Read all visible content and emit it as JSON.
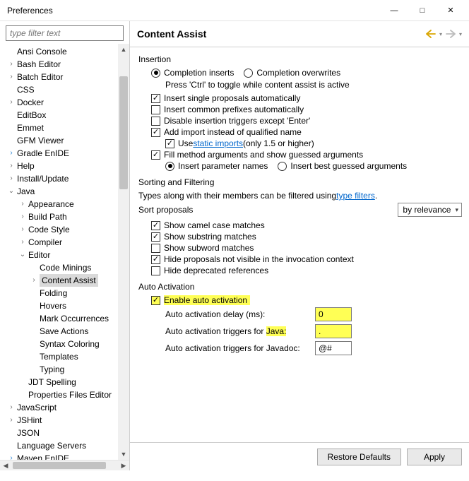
{
  "window": {
    "title": "Preferences"
  },
  "filter": {
    "placeholder": "type filter text"
  },
  "tree": {
    "items": [
      {
        "label": "Ansi Console",
        "tw": "",
        "depth": 0
      },
      {
        "label": "Bash Editor",
        "tw": ">",
        "depth": 0
      },
      {
        "label": "Batch Editor",
        "tw": ">",
        "depth": 0
      },
      {
        "label": "CSS",
        "tw": "",
        "depth": 0
      },
      {
        "label": "Docker",
        "tw": ">",
        "depth": 0
      },
      {
        "label": "EditBox",
        "tw": "",
        "depth": 0
      },
      {
        "label": "Emmet",
        "tw": "",
        "depth": 0
      },
      {
        "label": "GFM Viewer",
        "tw": "",
        "depth": 0
      },
      {
        "label": "Gradle EnIDE",
        "tw": ">",
        "depth": 0,
        "twClass": "blue"
      },
      {
        "label": "Help",
        "tw": ">",
        "depth": 0
      },
      {
        "label": "Install/Update",
        "tw": ">",
        "depth": 0
      },
      {
        "label": "Java",
        "tw": "v",
        "depth": 0
      },
      {
        "label": "Appearance",
        "tw": ">",
        "depth": 1
      },
      {
        "label": "Build Path",
        "tw": ">",
        "depth": 1
      },
      {
        "label": "Code Style",
        "tw": ">",
        "depth": 1
      },
      {
        "label": "Compiler",
        "tw": ">",
        "depth": 1
      },
      {
        "label": "Editor",
        "tw": "v",
        "depth": 1
      },
      {
        "label": "Code Minings",
        "tw": "",
        "depth": 2
      },
      {
        "label": "Content Assist",
        "tw": ">",
        "depth": 2,
        "selected": true
      },
      {
        "label": "Folding",
        "tw": "",
        "depth": 2
      },
      {
        "label": "Hovers",
        "tw": "",
        "depth": 2
      },
      {
        "label": "Mark Occurrences",
        "tw": "",
        "depth": 2
      },
      {
        "label": "Save Actions",
        "tw": "",
        "depth": 2
      },
      {
        "label": "Syntax Coloring",
        "tw": "",
        "depth": 2
      },
      {
        "label": "Templates",
        "tw": "",
        "depth": 2
      },
      {
        "label": "Typing",
        "tw": "",
        "depth": 2
      },
      {
        "label": "JDT Spelling",
        "tw": "",
        "depth": 1
      },
      {
        "label": "Properties Files Editor",
        "tw": "",
        "depth": 1
      },
      {
        "label": "JavaScript",
        "tw": ">",
        "depth": 0
      },
      {
        "label": "JSHint",
        "tw": ">",
        "depth": 0
      },
      {
        "label": "JSON",
        "tw": "",
        "depth": 0
      },
      {
        "label": "Language Servers",
        "tw": "",
        "depth": 0
      },
      {
        "label": "Maven EnIDE",
        "tw": ">",
        "depth": 0,
        "twClass": "blue"
      }
    ]
  },
  "header": {
    "title": "Content Assist"
  },
  "insertion": {
    "title": "Insertion",
    "mode_inserts": "Completion inserts",
    "mode_overwrites": "Completion overwrites",
    "hint": "Press 'Ctrl' to toggle while content assist is active",
    "insert_single": "Insert single proposals automatically",
    "insert_prefixes": "Insert common prefixes automatically",
    "disable_triggers": "Disable insertion triggers except 'Enter'",
    "add_import": "Add import instead of qualified name",
    "use_static_pre": "Use ",
    "use_static_link": "static imports",
    "use_static_post": " (only 1.5 or higher)",
    "fill_method": "Fill method arguments and show guessed arguments",
    "param_names": "Insert parameter names",
    "best_guessed": "Insert best guessed arguments"
  },
  "sort": {
    "title": "Sorting and Filtering",
    "hint_pre": "Types along with their members can be filtered using ",
    "hint_link": "type filters",
    "hint_post": ".",
    "label": "Sort proposals",
    "value": "by relevance",
    "camel": "Show camel case matches",
    "substring": "Show substring matches",
    "subword": "Show subword matches",
    "hide_invoc": "Hide proposals not visible in the invocation context",
    "hide_deprecated": "Hide deprecated references"
  },
  "auto": {
    "title": "Auto Activation",
    "enable": "Enable auto activation",
    "delay_label": "Auto activation delay (ms):",
    "delay_value": "0",
    "java_label_pre": "Auto activation triggers for ",
    "java_label_hl": "Java:",
    "java_value": ".",
    "javadoc_label": "Auto activation triggers for Javadoc:",
    "javadoc_value": "@#"
  },
  "footer": {
    "restore": "Restore Defaults",
    "apply": "Apply"
  }
}
